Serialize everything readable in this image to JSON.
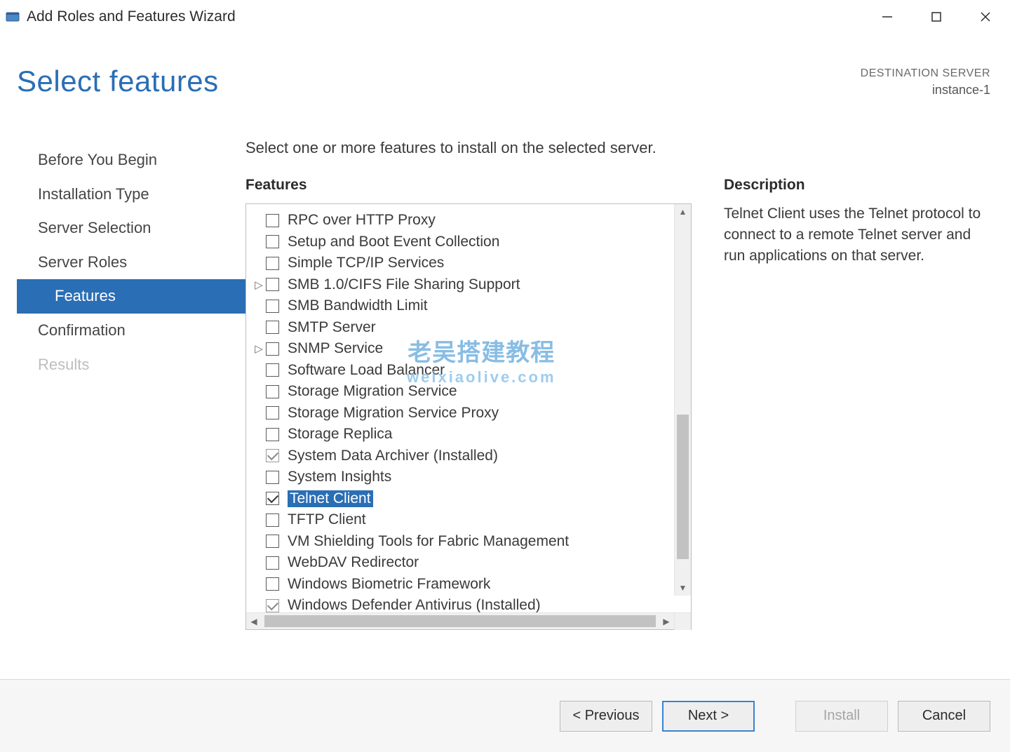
{
  "window": {
    "title": "Add Roles and Features Wizard"
  },
  "header": {
    "page_title": "Select features",
    "destination_label": "DESTINATION SERVER",
    "destination_value": "instance-1"
  },
  "sidebar": {
    "items": [
      {
        "label": "Before You Begin",
        "state": "normal"
      },
      {
        "label": "Installation Type",
        "state": "normal"
      },
      {
        "label": "Server Selection",
        "state": "normal"
      },
      {
        "label": "Server Roles",
        "state": "normal"
      },
      {
        "label": "Features",
        "state": "active"
      },
      {
        "label": "Confirmation",
        "state": "normal"
      },
      {
        "label": "Results",
        "state": "disabled"
      }
    ]
  },
  "content": {
    "instruction": "Select one or more features to install on the selected server.",
    "features_label": "Features",
    "description_label": "Description",
    "description_text": "Telnet Client uses the Telnet protocol to connect to a remote Telnet server and run applications on that server."
  },
  "features": [
    {
      "label": "RPC over HTTP Proxy",
      "checked": false,
      "installed": false,
      "expandable": false,
      "selected": false
    },
    {
      "label": "Setup and Boot Event Collection",
      "checked": false,
      "installed": false,
      "expandable": false,
      "selected": false
    },
    {
      "label": "Simple TCP/IP Services",
      "checked": false,
      "installed": false,
      "expandable": false,
      "selected": false
    },
    {
      "label": "SMB 1.0/CIFS File Sharing Support",
      "checked": false,
      "installed": false,
      "expandable": true,
      "selected": false
    },
    {
      "label": "SMB Bandwidth Limit",
      "checked": false,
      "installed": false,
      "expandable": false,
      "selected": false
    },
    {
      "label": "SMTP Server",
      "checked": false,
      "installed": false,
      "expandable": false,
      "selected": false
    },
    {
      "label": "SNMP Service",
      "checked": false,
      "installed": false,
      "expandable": true,
      "selected": false
    },
    {
      "label": "Software Load Balancer",
      "checked": false,
      "installed": false,
      "expandable": false,
      "selected": false
    },
    {
      "label": "Storage Migration Service",
      "checked": false,
      "installed": false,
      "expandable": false,
      "selected": false
    },
    {
      "label": "Storage Migration Service Proxy",
      "checked": false,
      "installed": false,
      "expandable": false,
      "selected": false
    },
    {
      "label": "Storage Replica",
      "checked": false,
      "installed": false,
      "expandable": false,
      "selected": false
    },
    {
      "label": "System Data Archiver (Installed)",
      "checked": false,
      "installed": true,
      "expandable": false,
      "selected": false
    },
    {
      "label": "System Insights",
      "checked": false,
      "installed": false,
      "expandable": false,
      "selected": false
    },
    {
      "label": "Telnet Client",
      "checked": true,
      "installed": false,
      "expandable": false,
      "selected": true
    },
    {
      "label": "TFTP Client",
      "checked": false,
      "installed": false,
      "expandable": false,
      "selected": false
    },
    {
      "label": "VM Shielding Tools for Fabric Management",
      "checked": false,
      "installed": false,
      "expandable": false,
      "selected": false
    },
    {
      "label": "WebDAV Redirector",
      "checked": false,
      "installed": false,
      "expandable": false,
      "selected": false
    },
    {
      "label": "Windows Biometric Framework",
      "checked": false,
      "installed": false,
      "expandable": false,
      "selected": false
    },
    {
      "label": "Windows Defender Antivirus (Installed)",
      "checked": false,
      "installed": true,
      "expandable": false,
      "selected": false
    }
  ],
  "footer": {
    "previous": "< Previous",
    "next": "Next >",
    "install": "Install",
    "cancel": "Cancel"
  },
  "watermark": {
    "line1": "老吴搭建教程",
    "line2": "weixiaolive.com"
  }
}
